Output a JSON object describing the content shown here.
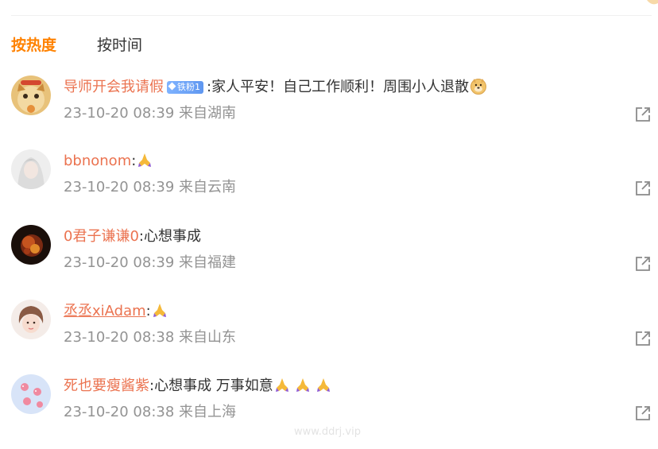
{
  "tabs": {
    "hot": "按热度",
    "time": "按时间"
  },
  "colors": {
    "accent": "#ff8200",
    "username": "#eb7350",
    "meta": "#939393"
  },
  "comments": [
    {
      "username": "导师开会我请假",
      "badge": "铁粉1",
      "text": ":家人平安！自己工作顺利！周围小人退散",
      "emoji": "doge-icon",
      "time": "23-10-20 08:39",
      "location": "来自湖南"
    },
    {
      "username": "bbnonom",
      "text": ":",
      "emoji": "pray-icon",
      "time": "23-10-20 08:39",
      "location": "来自云南"
    },
    {
      "username": "0君子谦谦0",
      "text": ":心想事成",
      "time": "23-10-20 08:39",
      "location": "来自福建"
    },
    {
      "username": "丞丞xiAdam",
      "text": ":",
      "emoji": "pray-icon",
      "time": "23-10-20 08:38",
      "location": "来自山东"
    },
    {
      "username": "死也要瘦酱紫",
      "text": ":心想事成 万事如意",
      "emoji": "pray-icon x3",
      "time": "23-10-20 08:38",
      "location": "来自上海"
    }
  ],
  "watermark": "www.ddrj.vip"
}
